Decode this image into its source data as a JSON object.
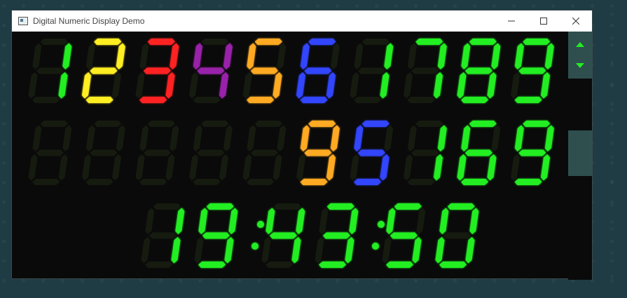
{
  "window": {
    "title": "Digital Numeric Display Demo"
  },
  "colors": {
    "green": "#22ee22",
    "yellow": "#ffee22",
    "red": "#ff2222",
    "purple": "#9922aa",
    "orange": "#ffaa22",
    "blue": "#3344ff",
    "off": "#161b10"
  },
  "displays": [
    {
      "name": "row-1",
      "digits": [
        {
          "d": "1",
          "c": "green"
        },
        {
          "d": "2",
          "c": "yellow"
        },
        {
          "d": "3",
          "c": "red"
        },
        {
          "d": "4",
          "c": "purple"
        },
        {
          "d": "5",
          "c": "orange"
        },
        {
          "d": "6",
          "c": "blue"
        },
        {
          "d": "1",
          "c": "green"
        },
        {
          "d": "7",
          "c": "green"
        },
        {
          "d": "8",
          "c": "green"
        },
        {
          "d": "9",
          "c": "green"
        }
      ]
    },
    {
      "name": "row-2",
      "digits": [
        {
          "d": "",
          "c": "green"
        },
        {
          "d": "",
          "c": "green"
        },
        {
          "d": "",
          "c": "green"
        },
        {
          "d": "",
          "c": "red"
        },
        {
          "d": "",
          "c": "purple"
        },
        {
          "d": "9",
          "c": "orange"
        },
        {
          "d": "5",
          "c": "blue"
        },
        {
          "d": "1",
          "c": "green"
        },
        {
          "d": "6",
          "c": "green"
        },
        {
          "d": "9",
          "c": "green"
        }
      ]
    },
    {
      "name": "clock",
      "time": "19:43:50",
      "c": "green"
    }
  ],
  "scrollbar": {
    "up": "scroll-up-arrow-icon",
    "down": "scroll-down-arrow-icon"
  }
}
